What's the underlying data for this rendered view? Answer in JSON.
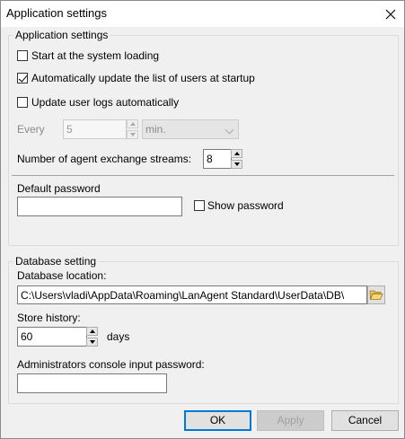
{
  "window": {
    "title": "Application settings"
  },
  "app_group": {
    "legend": "Application settings",
    "start_loading": {
      "label": "Start at the system loading",
      "checked": false
    },
    "auto_update": {
      "label": "Automatically update the list of users at startup",
      "checked": true
    },
    "update_logs": {
      "label": "Update user logs automatically",
      "checked": false
    },
    "every_label": "Every",
    "every_value": "5",
    "unit_value": "min.",
    "streams_label": "Number of agent exchange streams:",
    "streams_value": "8",
    "default_password_label": "Default password",
    "default_password_value": "",
    "show_password": {
      "label": "Show password",
      "checked": false
    }
  },
  "db_group": {
    "legend": "Database setting",
    "location_label": "Database location:",
    "location_value": "C:\\Users\\vladi\\AppData\\Roaming\\LanAgent Standard\\UserData\\DB\\",
    "history_label": "Store history:",
    "history_value": "60",
    "days_label": "days",
    "admin_password_label": "Administrators console input password:",
    "admin_password_value": ""
  },
  "buttons": {
    "ok": "OK",
    "apply": "Apply",
    "cancel": "Cancel"
  }
}
